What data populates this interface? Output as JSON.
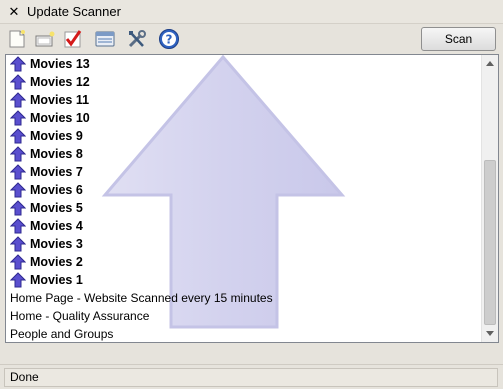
{
  "window": {
    "title": "Update Scanner",
    "close_glyph": "✕"
  },
  "toolbar": {
    "icons": [
      "new-page-icon",
      "open-sidebar-icon",
      "checkmark-icon",
      "scan-all-icon",
      "settings-icon",
      "help-icon"
    ],
    "scan_label": "Scan"
  },
  "list": {
    "updated_items": [
      "Movies 13",
      "Movies 12",
      "Movies 11",
      "Movies 10",
      "Movies 9",
      "Movies 8",
      "Movies 7",
      "Movies 6",
      "Movies 5",
      "Movies 4",
      "Movies 3",
      "Movies 2",
      "Movies 1"
    ],
    "plain_items": [
      "Home Page - Website Scanned every 15 minutes",
      "Home - Quality Assurance",
      "People and Groups"
    ]
  },
  "status": {
    "text": "Done"
  },
  "colors": {
    "arrow": "#5a4fcf",
    "watermark": "#d4d3ef"
  }
}
